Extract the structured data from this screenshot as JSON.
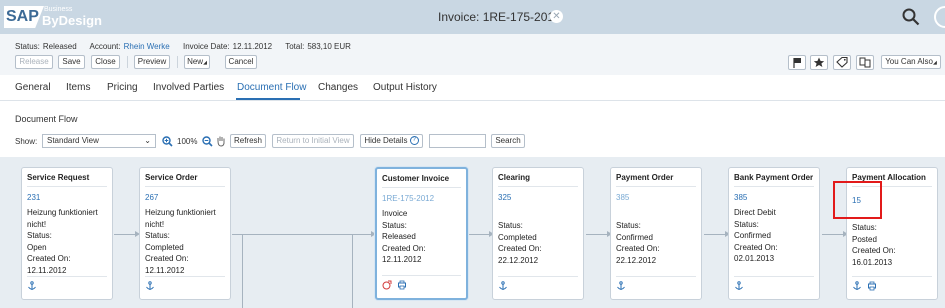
{
  "app": {
    "logo_sap": "SAP",
    "logo_business": "Business",
    "logo_bydesign": "ByDesign",
    "window_title": "Invoice: 1RE-175-2012"
  },
  "status_bar": {
    "status_label": "Status:",
    "status_value": "Released",
    "account_label": "Account:",
    "account_value": "Rhein Werke",
    "invoice_date_label": "Invoice Date:",
    "invoice_date_value": "12.11.2012",
    "total_label": "Total:",
    "total_value": "583,10 EUR"
  },
  "toolbar": {
    "release": "Release",
    "save": "Save",
    "close": "Close",
    "preview": "Preview",
    "new": "New",
    "cancel": "Cancel",
    "you_can_also": "You Can Also"
  },
  "tabs": [
    "General",
    "Items",
    "Pricing",
    "Involved Parties",
    "Document Flow",
    "Changes",
    "Output History"
  ],
  "active_tab": "Document Flow",
  "section_title": "Document Flow",
  "flow_toolbar": {
    "show_label": "Show:",
    "view_value": "Standard View",
    "zoom": "100%",
    "refresh": "Refresh",
    "return_initial": "Return to Initial View",
    "hide_details": "Hide Details",
    "search_value": "",
    "search": "Search"
  },
  "cards": [
    {
      "title": "Service Request",
      "id": "231",
      "lines": [
        "Heizung funktioniert nicht!",
        "Status:",
        "Open",
        "Created On:",
        "12.11.2012"
      ]
    },
    {
      "title": "Service Order",
      "id": "267",
      "lines": [
        "Heizung funktioniert nicht!",
        "Status:",
        "Completed",
        "Created On:",
        "12.11.2012"
      ]
    },
    {
      "title": "Customer Invoice",
      "id": "1RE-175-2012",
      "lines": [
        "Invoice",
        "Status:",
        "Released",
        "Created On:",
        "12.11.2012"
      ]
    },
    {
      "title": "Clearing",
      "id": "325",
      "lines": [
        "Status:",
        "Completed",
        "Created On:",
        "22.12.2012"
      ]
    },
    {
      "title": "Payment Order",
      "id": "385",
      "lines": [
        "Status:",
        "Confirmed",
        "Created On:",
        "22.12.2012"
      ]
    },
    {
      "title": "Bank Payment Order",
      "id": "385",
      "lines": [
        "Direct Debit",
        "Status:",
        "Confirmed",
        "Created On:",
        "02.01.2013"
      ]
    },
    {
      "title": "Payment Allocation",
      "id": "15",
      "lines": [
        "Status:",
        "Posted",
        "Created On:",
        "16.01.2013"
      ]
    }
  ],
  "colors": {
    "accent": "#2a6fb3",
    "topbar": "#c9d7e3",
    "highlight": "#e21a1a"
  }
}
